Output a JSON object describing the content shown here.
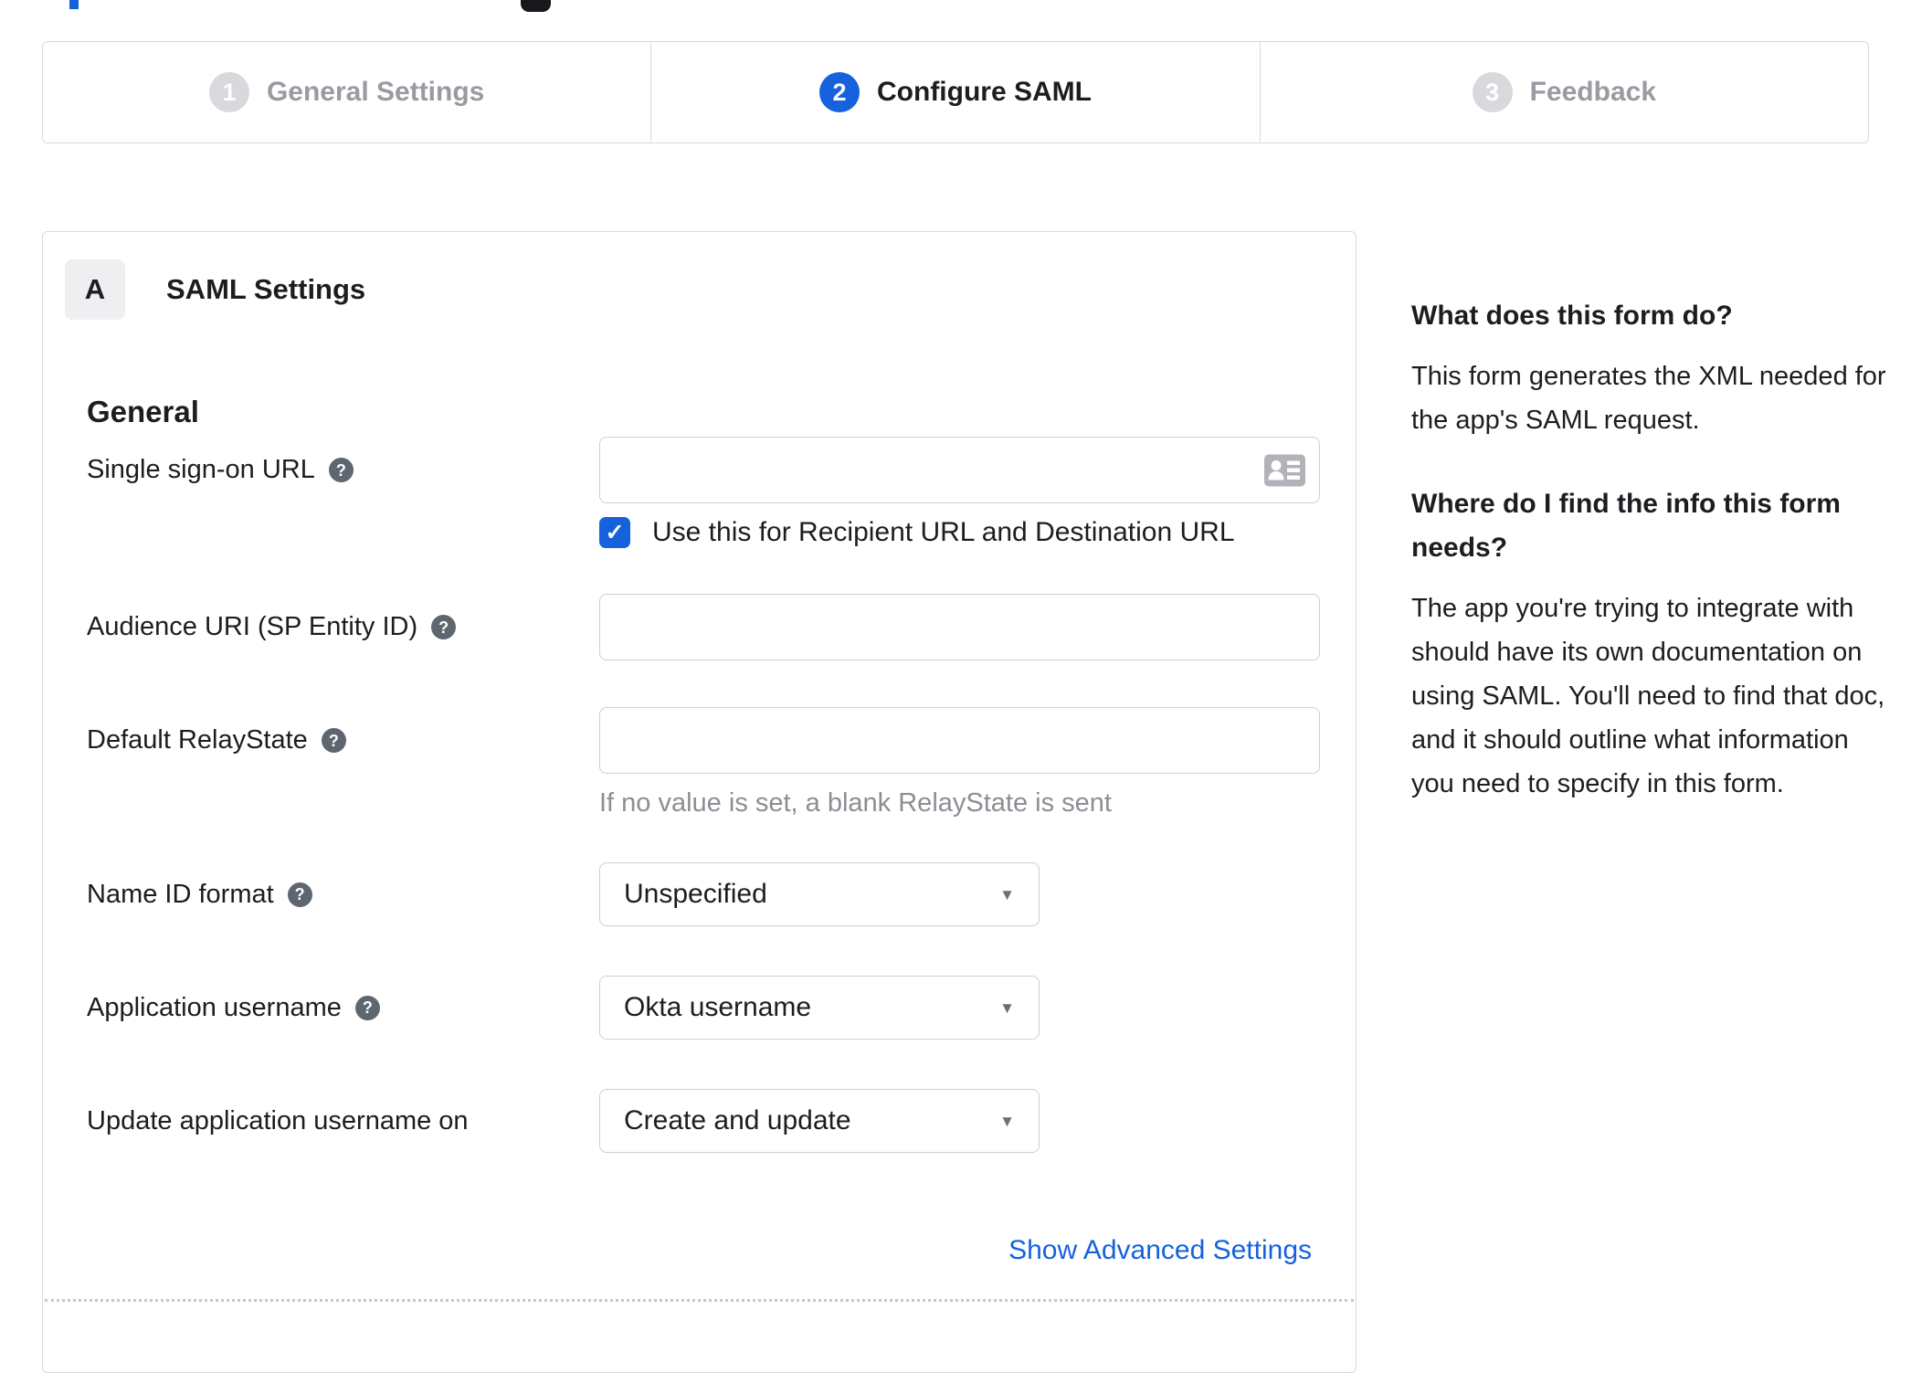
{
  "stepper": {
    "steps": [
      {
        "number": "1",
        "label": "General Settings",
        "state": "inactive"
      },
      {
        "number": "2",
        "label": "Configure SAML",
        "state": "active"
      },
      {
        "number": "3",
        "label": "Feedback",
        "state": "inactive"
      }
    ]
  },
  "panel": {
    "badge": "A",
    "title": "SAML Settings",
    "group": "General",
    "fields": {
      "sso": {
        "label": "Single sign-on URL",
        "value": "",
        "checkbox_label": "Use this for Recipient URL and Destination URL",
        "checked": true
      },
      "audience": {
        "label": "Audience URI (SP Entity ID)",
        "value": ""
      },
      "relaystate": {
        "label": "Default RelayState",
        "value": "",
        "hint": "If no value is set, a blank RelayState is sent"
      },
      "name_id": {
        "label": "Name ID format",
        "value": "Unspecified"
      },
      "app_username": {
        "label": "Application username",
        "value": "Okta username"
      },
      "update_username": {
        "label": "Update application username on",
        "value": "Create and update"
      }
    },
    "advanced_link": "Show Advanced Settings"
  },
  "sidebar": {
    "sections": [
      {
        "heading": "What does this form do?",
        "body": "This form generates the XML needed for the app's SAML request."
      },
      {
        "heading": "Where do I find the info this form needs?",
        "body": "The app you're trying to integrate with should have its own documentation on using SAML. You'll need to find that doc, and it should outline what information you need to specify in this form."
      }
    ]
  },
  "icons": {
    "help": "?",
    "check": "✓",
    "caret": "▼"
  },
  "colors": {
    "accent_blue": "#1662dd",
    "border_gray": "#d9d9dd",
    "inactive_gray": "#9a9aa2",
    "hint_gray": "#8d8d95",
    "help_icon_bg": "#5e6670",
    "text_dark": "#1d1d21"
  }
}
